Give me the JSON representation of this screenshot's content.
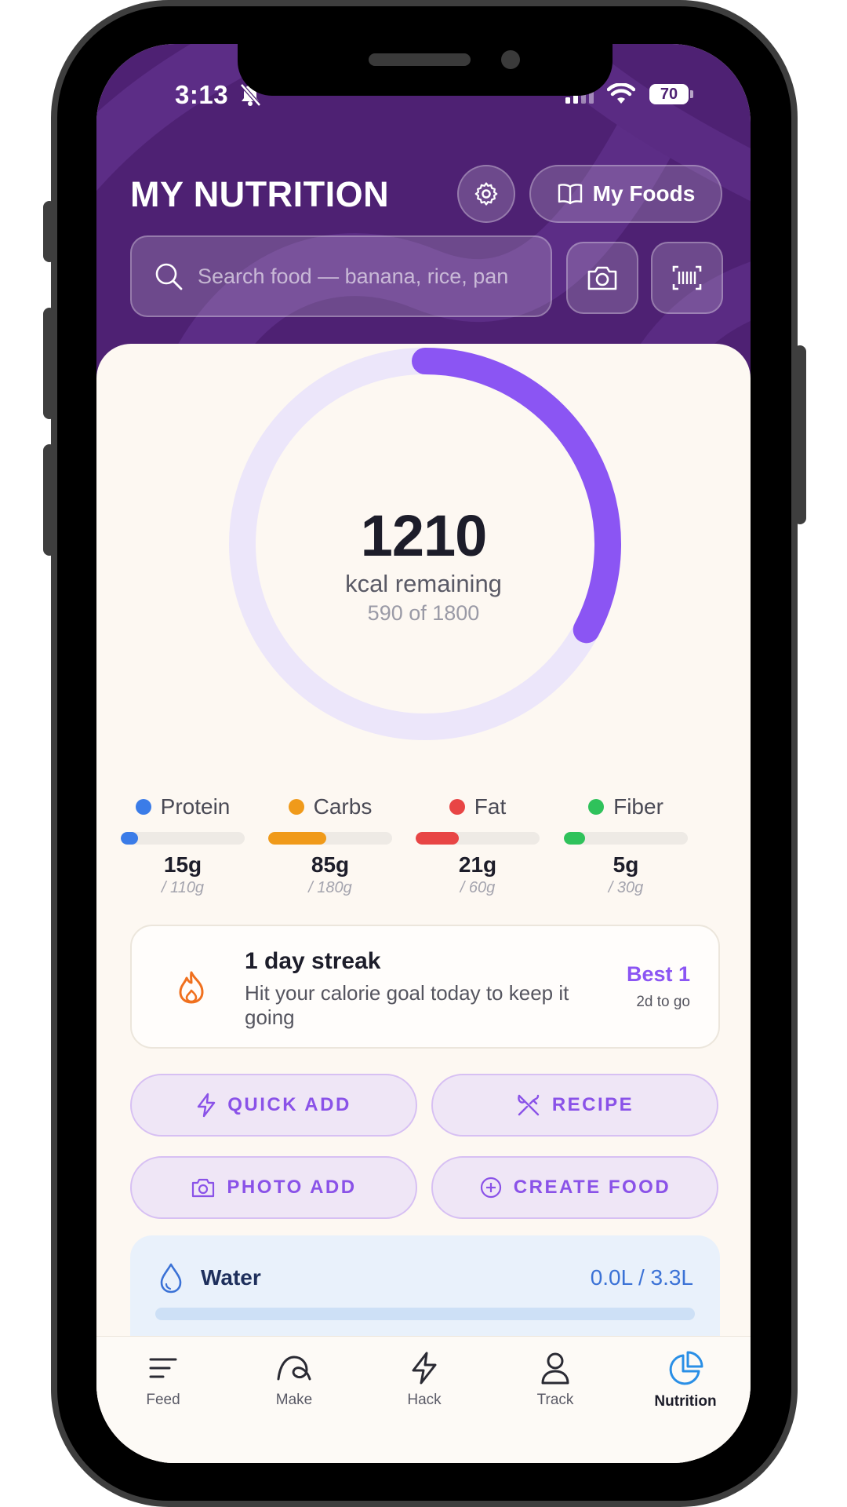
{
  "status_bar": {
    "time": "3:13",
    "battery": "70"
  },
  "header": {
    "title": "MY NUTRITION",
    "my_foods_label": "My Foods",
    "search_placeholder": "Search food — banana, rice, pan"
  },
  "calories": {
    "remaining": "1210",
    "remaining_label": "kcal remaining",
    "consumed_summary": "590 of 1800",
    "consumed": 590,
    "goal": 1800
  },
  "macros": [
    {
      "name": "Protein",
      "value": "15g",
      "goal": "/ 110g",
      "fraction": 0.14,
      "color": "#3b7ce8"
    },
    {
      "name": "Carbs",
      "value": "85g",
      "goal": "/ 180g",
      "fraction": 0.47,
      "color": "#f09a1a"
    },
    {
      "name": "Fat",
      "value": "21g",
      "goal": "/ 60g",
      "fraction": 0.35,
      "color": "#e84545"
    },
    {
      "name": "Fiber",
      "value": "5g",
      "goal": "/ 30g",
      "fraction": 0.17,
      "color": "#2fc25b"
    }
  ],
  "streak": {
    "title": "1 day streak",
    "description": "Hit your calorie goal today to keep it going",
    "best": "Best 1",
    "to_go": "2d to go"
  },
  "actions": {
    "quick_add": "QUICK ADD",
    "recipe": "RECIPE",
    "photo_add": "PHOTO ADD",
    "create_food": "CREATE FOOD"
  },
  "water": {
    "label": "Water",
    "value": "0.0L / 3.3L",
    "fraction": 0.0
  },
  "nav": {
    "feed": "Feed",
    "make": "Make",
    "hack": "Hack",
    "track": "Track",
    "nutrition": "Nutrition"
  },
  "colors": {
    "header": "#4e2173",
    "accent": "#8b55f3",
    "ring_track": "#ece6fa",
    "active_nav": "#2a8fe6"
  }
}
